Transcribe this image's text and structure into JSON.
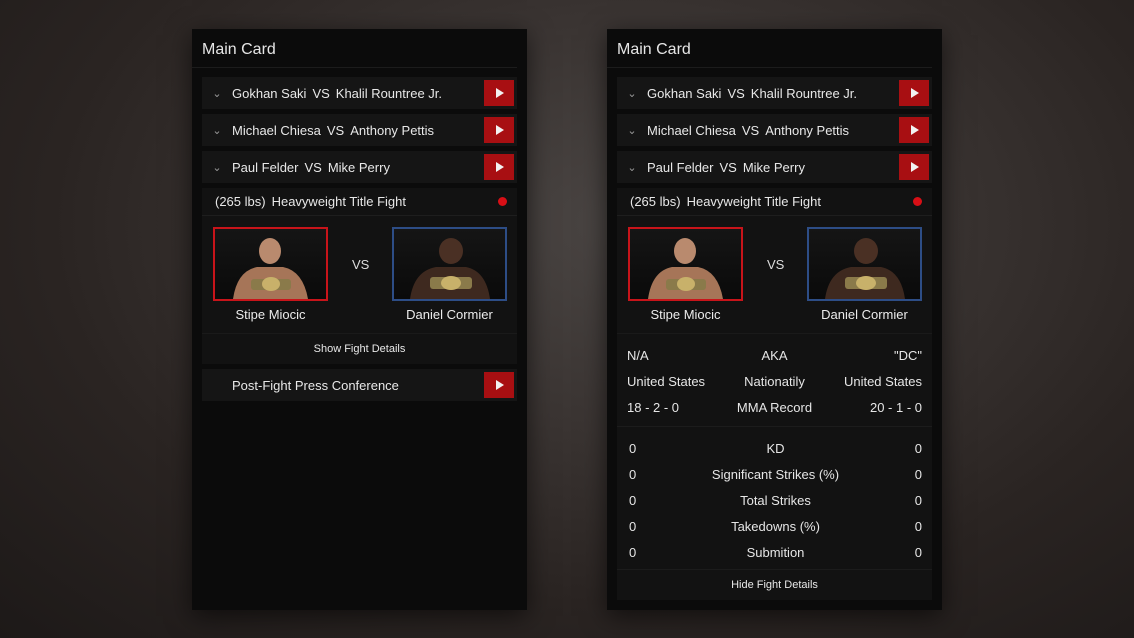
{
  "left": {
    "title": "Main Card",
    "fights": [
      {
        "red": "Gokhan Saki",
        "vs": "VS",
        "blue": "Khalil Rountree Jr."
      },
      {
        "red": "Michael Chiesa",
        "vs": "VS",
        "blue": "Anthony Pettis"
      },
      {
        "red": "Paul Felder",
        "vs": "VS",
        "blue": "Mike Perry"
      }
    ],
    "featured": {
      "weight": "(265 lbs)",
      "bout": "Heavyweight Title Fight",
      "vs": "VS",
      "red_name": "Stipe Miocic",
      "blue_name": "Daniel Cormier",
      "toggle": "Show Fight Details"
    },
    "press": "Post-Fight Press Conference"
  },
  "right": {
    "title": "Main Card",
    "fights": [
      {
        "red": "Gokhan Saki",
        "vs": "VS",
        "blue": "Khalil Rountree Jr."
      },
      {
        "red": "Michael Chiesa",
        "vs": "VS",
        "blue": "Anthony Pettis"
      },
      {
        "red": "Paul Felder",
        "vs": "VS",
        "blue": "Mike Perry"
      }
    ],
    "featured": {
      "weight": "(265 lbs)",
      "bout": "Heavyweight Title Fight",
      "vs": "VS",
      "red_name": "Stipe Miocic",
      "blue_name": "Daniel Cormier",
      "toggle": "Hide Fight Details"
    },
    "info": [
      {
        "red": "N/A",
        "label": "AKA",
        "blue": "\"DC\""
      },
      {
        "red": "United States",
        "label": "Nationatily",
        "blue": "United States"
      },
      {
        "red": "18 - 2 - 0",
        "label": "MMA Record",
        "blue": "20 - 1 - 0"
      }
    ],
    "stats": [
      {
        "red": "0",
        "label": "KD",
        "blue": "0"
      },
      {
        "red": "0",
        "label": "Significant Strikes (%)",
        "blue": "0"
      },
      {
        "red": "0",
        "label": "Total Strikes",
        "blue": "0"
      },
      {
        "red": "0",
        "label": "Takedowns (%)",
        "blue": "0"
      },
      {
        "red": "0",
        "label": "Submition",
        "blue": "0"
      }
    ]
  },
  "colors": {
    "accent_red": "#a80f12",
    "corner_red": "#c8141a",
    "corner_blue": "#2d4d86",
    "live_dot": "#d80f16"
  },
  "icons": {
    "chevron": "chevron-down-icon",
    "play": "play-icon",
    "live": "live-indicator-dot"
  }
}
